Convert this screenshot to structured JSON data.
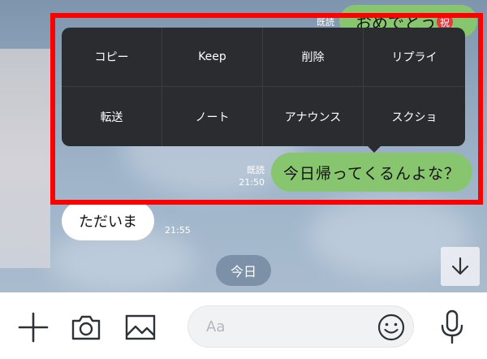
{
  "messages": {
    "top_sent_text": "おめでとう",
    "top_sent_badge": "祝",
    "top_read_label": "既読",
    "main_sent_text": "今日帰ってくるんよな？",
    "main_read_label": "既読",
    "main_time": "21:50",
    "received_text": "ただいま",
    "received_time": "21:55"
  },
  "date_separator": "今日",
  "context_menu": {
    "items": [
      {
        "label": "コピー"
      },
      {
        "label": "Keep"
      },
      {
        "label": "削除"
      },
      {
        "label": "リプライ"
      },
      {
        "label": "転送"
      },
      {
        "label": "ノート"
      },
      {
        "label": "アナウンス"
      },
      {
        "label": "スクショ"
      }
    ]
  },
  "input_bar": {
    "placeholder": "Aa",
    "icons": [
      "plus-icon",
      "camera-icon",
      "image-icon",
      "emoji-icon",
      "mic-icon"
    ]
  },
  "colors": {
    "chat_background": "#8fa5bc",
    "sent_bubble": "#88c56f",
    "received_bubble": "#ffffff",
    "menu_background": "#2a2c30",
    "highlight": "#ff0000"
  }
}
